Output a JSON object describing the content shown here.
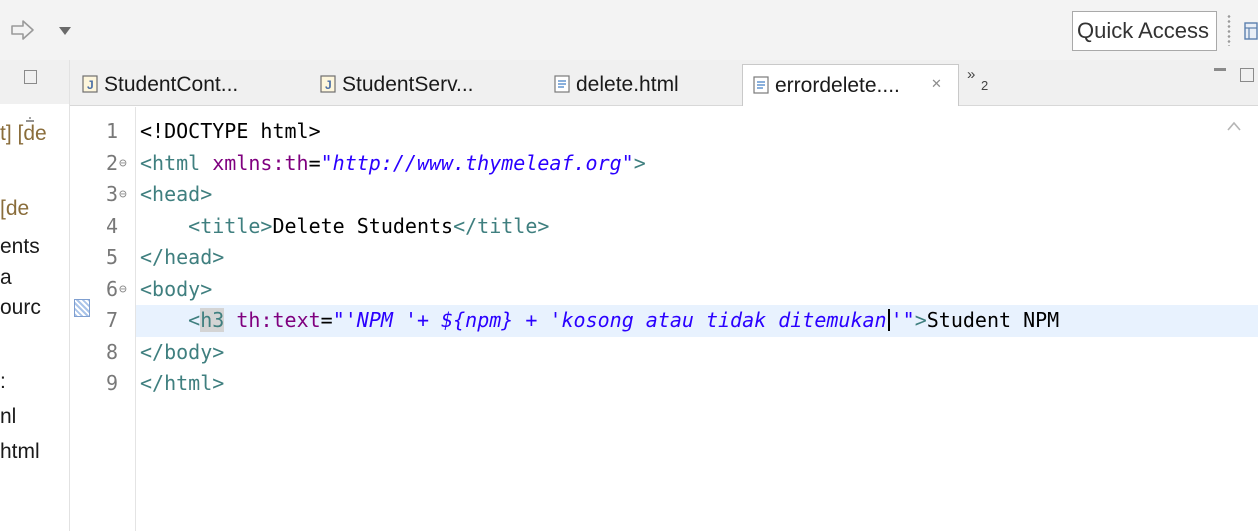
{
  "toolbar": {
    "quick_access_label": "Quick Access",
    "icons": [
      "forward-arrow-icon",
      "chevron-down-icon",
      "perspective-icon"
    ]
  },
  "left_panel": {
    "fragments": [
      {
        "text": "t] [de",
        "style": "decor"
      },
      {
        "text": "[de",
        "style": "decor"
      },
      {
        "text": "ents",
        "style": "plain"
      },
      {
        "text": "a",
        "style": "plain"
      },
      {
        "text": "ourc",
        "style": "plain"
      },
      {
        "text": ":",
        "style": "plain"
      },
      {
        "text": "nl",
        "style": "plain"
      },
      {
        "text": "html",
        "style": "plain"
      }
    ]
  },
  "tabs": [
    {
      "label": "StudentCont...",
      "icon": "java-file-icon",
      "active": false
    },
    {
      "label": "StudentServ...",
      "icon": "java-file-icon",
      "active": false
    },
    {
      "label": "delete.html",
      "icon": "html-file-icon",
      "active": false
    },
    {
      "label": "errordelete....",
      "icon": "html-file-icon",
      "active": true
    }
  ],
  "tabs_overflow": {
    "symbol": "»",
    "count": "2"
  },
  "editor": {
    "line_numbers": [
      "1",
      "2",
      "3",
      "4",
      "5",
      "6",
      "7",
      "8",
      "9"
    ],
    "folding_lines": [
      "2",
      "3",
      "6"
    ],
    "current_line": "7",
    "lines": [
      {
        "segments": [
          {
            "t": "<!DOCTYPE html>",
            "c": "text"
          }
        ]
      },
      {
        "segments": [
          {
            "t": "<html ",
            "c": "tag"
          },
          {
            "t": "xmlns:th",
            "c": "attr"
          },
          {
            "t": "=",
            "c": "text"
          },
          {
            "t": "\"http://www.thymeleaf.org\"",
            "c": "str"
          },
          {
            "t": ">",
            "c": "tag"
          }
        ]
      },
      {
        "segments": [
          {
            "t": "<head>",
            "c": "tag"
          }
        ]
      },
      {
        "segments": [
          {
            "t": "    ",
            "c": "text"
          },
          {
            "t": "<title>",
            "c": "tag"
          },
          {
            "t": "Delete Students",
            "c": "text"
          },
          {
            "t": "</title>",
            "c": "tag"
          }
        ]
      },
      {
        "segments": [
          {
            "t": "</head>",
            "c": "tag"
          }
        ]
      },
      {
        "segments": [
          {
            "t": "<body>",
            "c": "tag"
          }
        ]
      },
      {
        "segments": [
          {
            "t": "    ",
            "c": "text"
          },
          {
            "t": "<",
            "c": "tag"
          },
          {
            "t": "h3",
            "c": "tag-hl"
          },
          {
            "t": " ",
            "c": "text"
          },
          {
            "t": "th:text",
            "c": "attr"
          },
          {
            "t": "=",
            "c": "text"
          },
          {
            "t": "\"'NPM '+ ${npm} + 'kosong atau tidak ditemukan",
            "c": "str"
          },
          {
            "t": "",
            "c": "caret"
          },
          {
            "t": "'\"",
            "c": "str"
          },
          {
            "t": ">",
            "c": "tag"
          },
          {
            "t": "Student NPM",
            "c": "text"
          }
        ]
      },
      {
        "segments": [
          {
            "t": "</body>",
            "c": "tag"
          }
        ]
      },
      {
        "segments": [
          {
            "t": "</html>",
            "c": "tag"
          }
        ]
      }
    ]
  }
}
